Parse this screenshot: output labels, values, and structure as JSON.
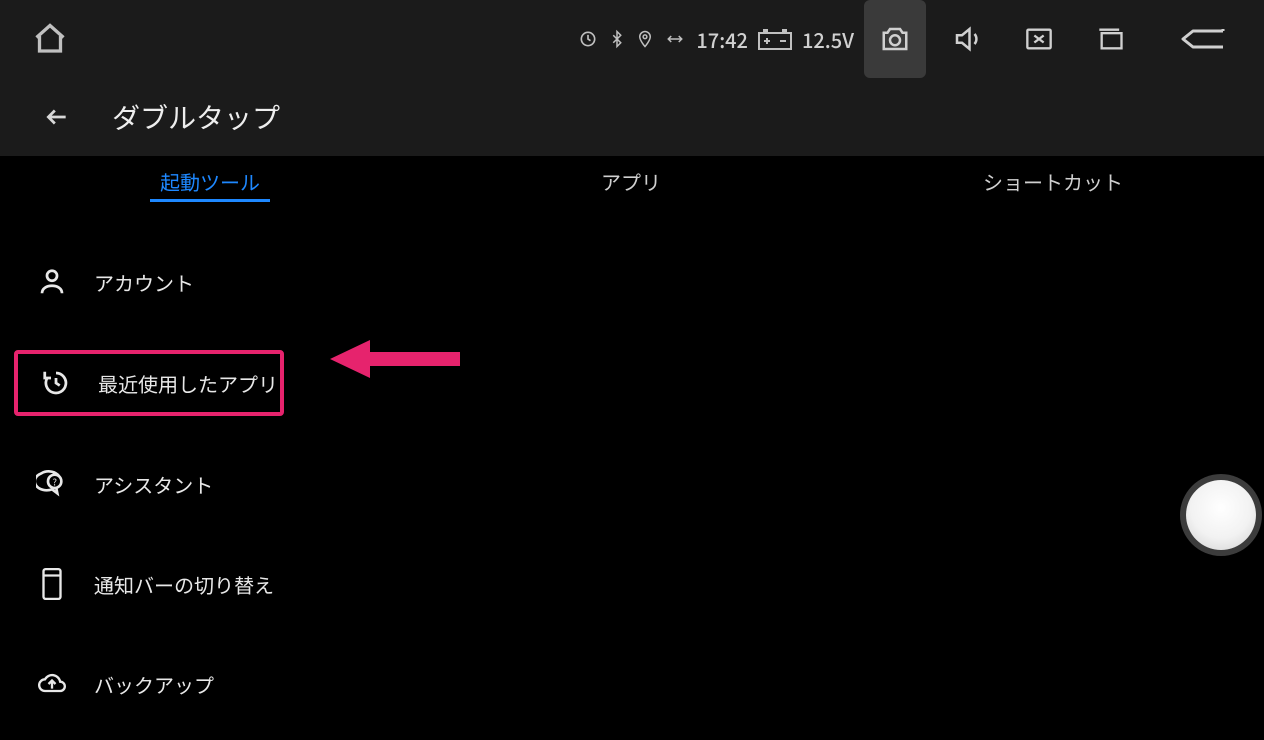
{
  "colors": {
    "accent": "#1e88ff",
    "highlight": "#e6236d"
  },
  "status": {
    "time": "17:42",
    "voltage": "12.5V"
  },
  "header": {
    "title": "ダブルタップ"
  },
  "tabs": [
    {
      "label": "起動ツール",
      "active": true
    },
    {
      "label": "アプリ",
      "active": false
    },
    {
      "label": "ショートカット",
      "active": false
    }
  ],
  "list": [
    {
      "icon": "account-icon",
      "label": "アカウント",
      "highlighted": false
    },
    {
      "icon": "recent-icon",
      "label": "最近使用したアプリ",
      "highlighted": true
    },
    {
      "icon": "assistant-icon",
      "label": "アシスタント",
      "highlighted": false
    },
    {
      "icon": "panel-icon",
      "label": "通知バーの切り替え",
      "highlighted": false
    },
    {
      "icon": "backup-icon",
      "label": "バックアップ",
      "highlighted": false
    }
  ]
}
